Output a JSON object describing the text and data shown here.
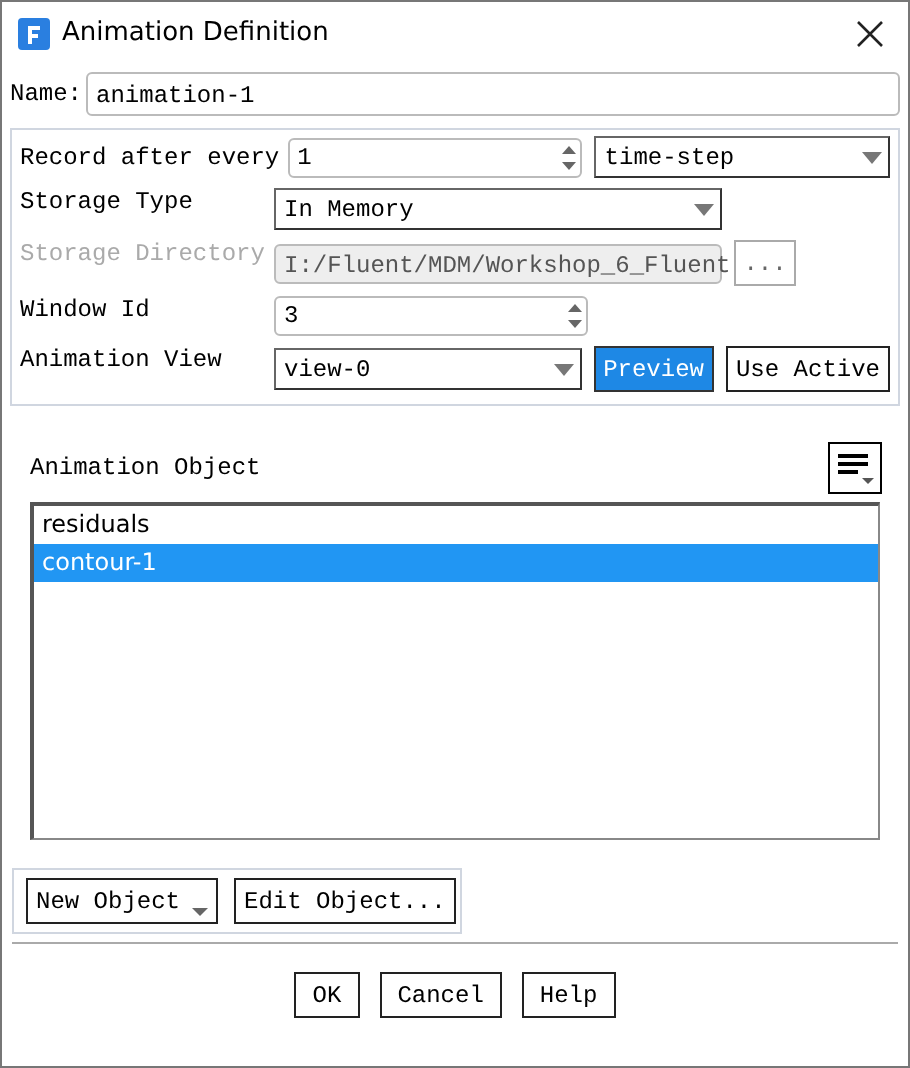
{
  "window": {
    "title": "Animation Definition"
  },
  "name": {
    "label": "Name:",
    "value": "animation-1"
  },
  "record": {
    "label": "Record after every",
    "value": "1",
    "unit": "time-step"
  },
  "storage_type": {
    "label": "Storage Type",
    "value": "In Memory"
  },
  "storage_directory": {
    "label": "Storage Directory",
    "value": "I:/Fluent/MDM/Workshop_6_Fluent",
    "disabled": true,
    "browse": "..."
  },
  "window_id": {
    "label": "Window Id",
    "value": "3"
  },
  "animation_view": {
    "label": "Animation View",
    "value": "view-0",
    "buttons": [
      {
        "label": "Preview",
        "selected": true
      },
      {
        "label": "Use Active",
        "selected": false
      }
    ]
  },
  "animation_object": {
    "label": "Animation Object",
    "items": [
      {
        "label": "residuals",
        "selected": false
      },
      {
        "label": "contour-1",
        "selected": true
      }
    ]
  },
  "object_buttons": [
    "New Object",
    "Edit Object..."
  ],
  "buttons": [
    "OK",
    "Cancel",
    "Help"
  ]
}
